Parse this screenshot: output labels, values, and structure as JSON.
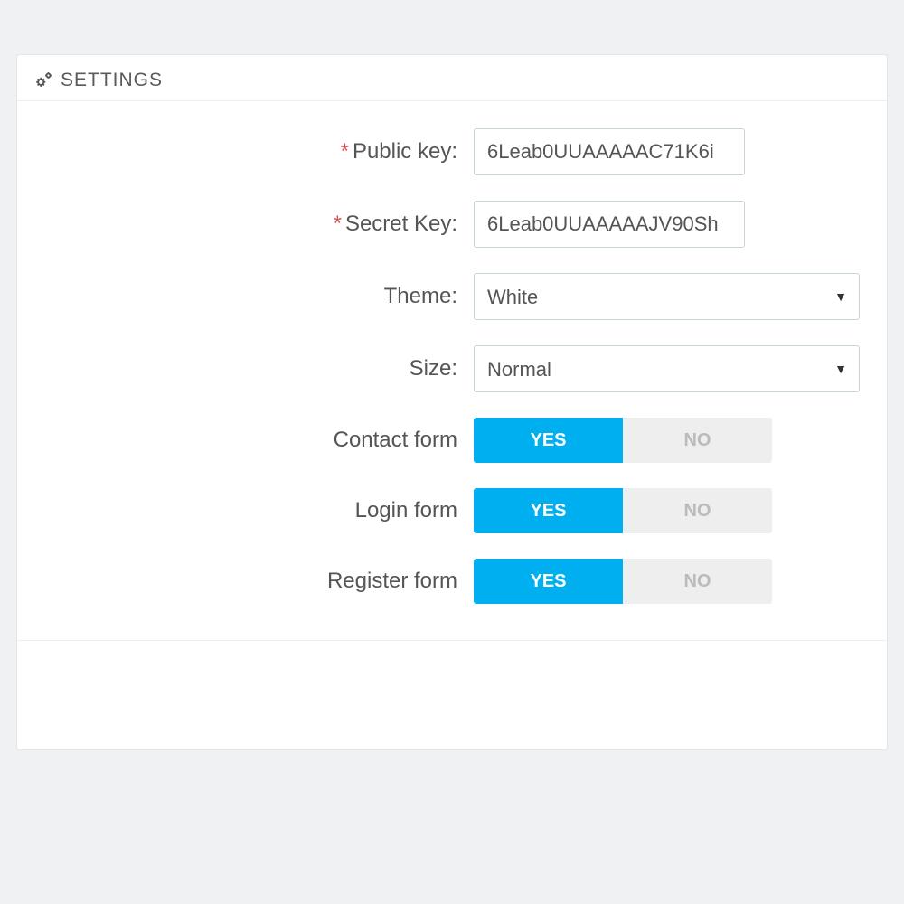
{
  "panel": {
    "title": "SETTINGS"
  },
  "fields": {
    "public_key": {
      "label": "Public key:",
      "value": "6Leab0UUAAAAAC71K6i"
    },
    "secret_key": {
      "label": "Secret Key:",
      "value": "6Leab0UUAAAAAJV90Sh"
    },
    "theme": {
      "label": "Theme:",
      "value": "White"
    },
    "size": {
      "label": "Size:",
      "value": "Normal"
    },
    "contact_form": {
      "label": "Contact form"
    },
    "login_form": {
      "label": "Login form"
    },
    "register_form": {
      "label": "Register form"
    }
  },
  "toggle": {
    "yes": "YES",
    "no": "NO"
  }
}
